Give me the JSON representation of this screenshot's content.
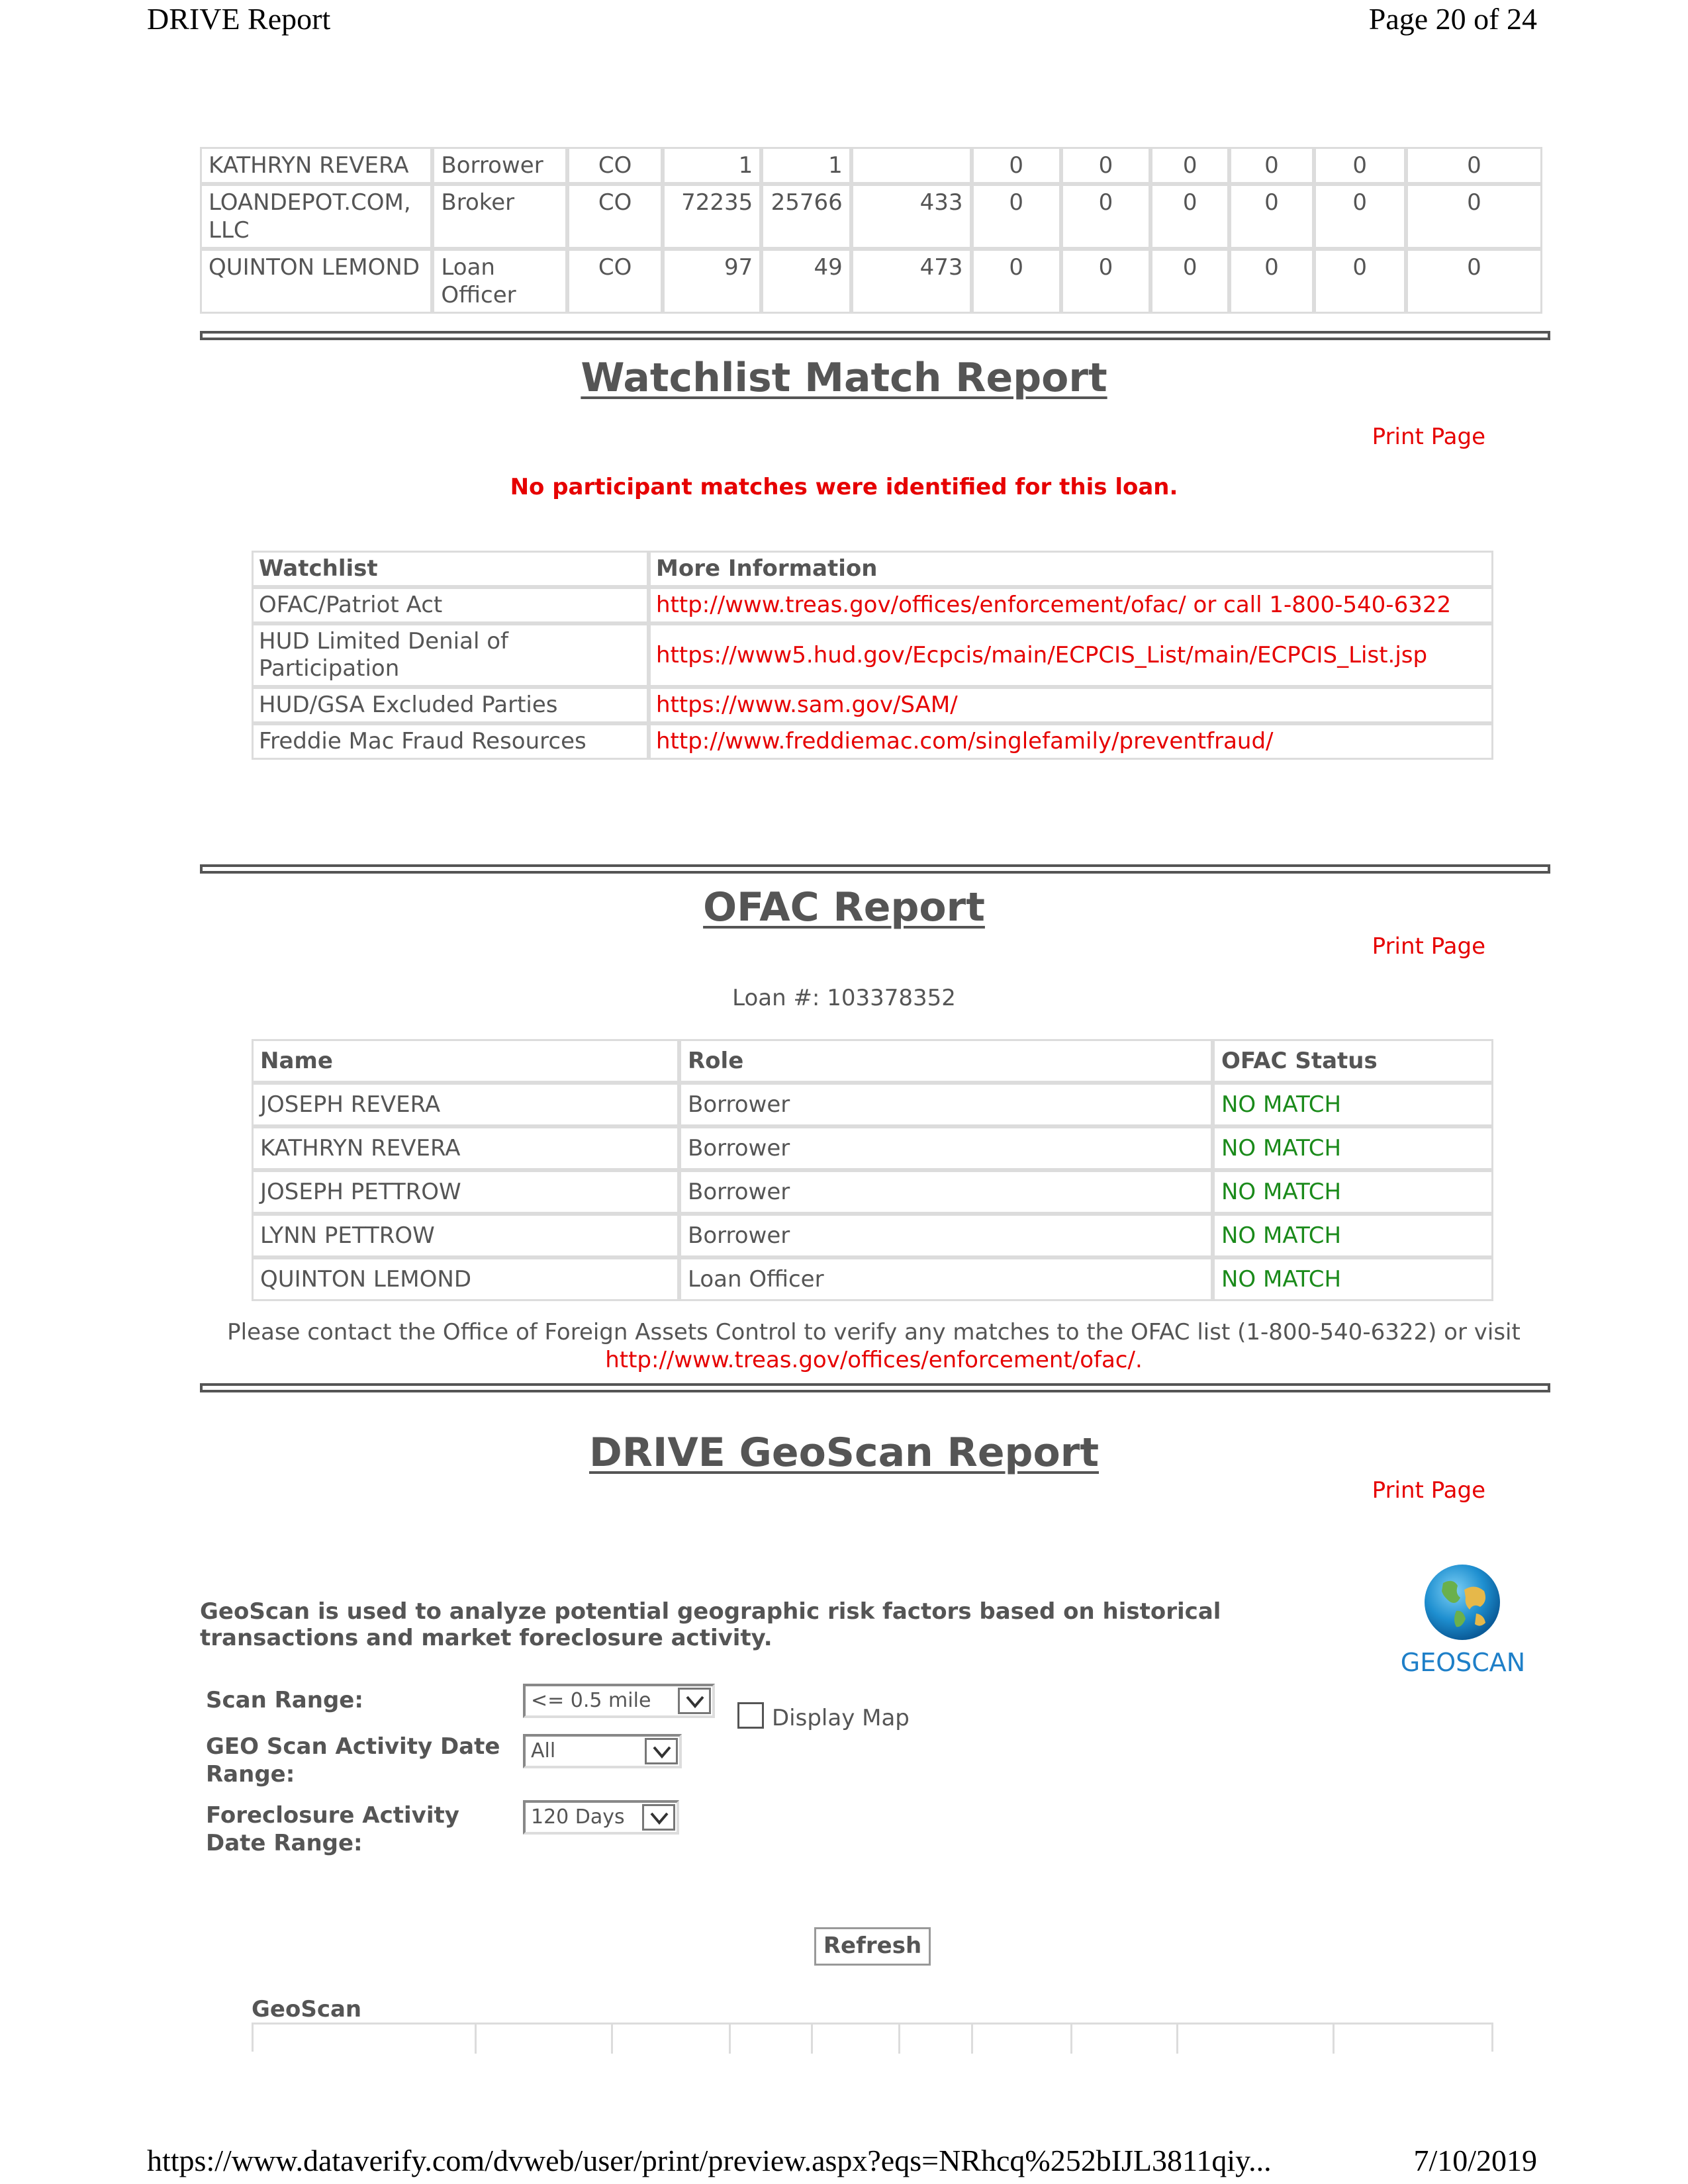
{
  "print_header": {
    "left": "DRIVE Report",
    "right": "Page 20 of 24"
  },
  "print_footer": {
    "left": "https://www.dataverify.com/dvweb/user/print/preview.aspx?eqs=NRhcq%252bIJL3811qiy...",
    "right": "7/10/2019"
  },
  "participants": [
    {
      "name": "KATHRYN REVERA",
      "role": "Borrower",
      "state": "CO",
      "c1": "1",
      "c2": "1",
      "c3": "",
      "c4": "0",
      "c5": "0",
      "c6": "0",
      "c7": "0",
      "c8": "0",
      "c9": "0"
    },
    {
      "name": "LOANDEPOT.COM, LLC",
      "role": "Broker",
      "state": "CO",
      "c1": "72235",
      "c2": "25766",
      "c3": "433",
      "c4": "0",
      "c5": "0",
      "c6": "0",
      "c7": "0",
      "c8": "0",
      "c9": "0"
    },
    {
      "name": "QUINTON LEMOND",
      "role": "Loan Officer",
      "state": "CO",
      "c1": "97",
      "c2": "49",
      "c3": "473",
      "c4": "0",
      "c5": "0",
      "c6": "0",
      "c7": "0",
      "c8": "0",
      "c9": "0"
    }
  ],
  "watchlist": {
    "title": "Watchlist Match Report",
    "print_label": "Print Page",
    "message": "No participant matches were identified for this loan.",
    "headers": [
      "Watchlist",
      "More Information"
    ],
    "rows": [
      {
        "name": "OFAC/Patriot Act",
        "info": "http://www.treas.gov/offices/enforcement/ofac/ or call 1-800-540-6322"
      },
      {
        "name": "HUD Limited Denial of Participation",
        "info": "https://www5.hud.gov/Ecpcis/main/ECPCIS_List/main/ECPCIS_List.jsp"
      },
      {
        "name": "HUD/GSA Excluded Parties",
        "info": "https://www.sam.gov/SAM/"
      },
      {
        "name": "Freddie Mac Fraud Resources",
        "info": "http://www.freddiemac.com/singlefamily/preventfraud/"
      }
    ]
  },
  "ofac": {
    "title": "OFAC Report",
    "print_label": "Print Page",
    "loan_line": "Loan #: 103378352",
    "headers": [
      "Name",
      "Role",
      "OFAC Status"
    ],
    "rows": [
      {
        "name": "JOSEPH REVERA",
        "role": "Borrower",
        "status": "NO MATCH"
      },
      {
        "name": "KATHRYN REVERA",
        "role": "Borrower",
        "status": "NO MATCH"
      },
      {
        "name": "JOSEPH PETTROW",
        "role": "Borrower",
        "status": "NO MATCH"
      },
      {
        "name": "LYNN PETTROW",
        "role": "Borrower",
        "status": "NO MATCH"
      },
      {
        "name": "QUINTON LEMOND",
        "role": "Loan Officer",
        "status": "NO MATCH"
      }
    ],
    "note_text": "Please contact the Office of Foreign Assets Control to verify any matches to the OFAC list (1-800-540-6322) or visit",
    "note_link": "http://www.treas.gov/offices/enforcement/ofac/",
    "note_end": "."
  },
  "geoscan": {
    "title": "DRIVE GeoScan Report",
    "print_label": "Print Page",
    "description": "GeoScan is used to analyze potential geographic risk factors based on historical transactions and market foreclosure activity.",
    "logo_text": "GEOSCAN",
    "scan_range_label": "Scan Range:",
    "scan_range_value": "<= 0.5 mile",
    "display_map_label": "Display Map",
    "activity_date_label": "GEO Scan Activity Date Range:",
    "activity_date_value": "All",
    "foreclosure_label": "Foreclosure Activity Date Range:",
    "foreclosure_value": "120 Days",
    "refresh_label": "Refresh",
    "table_label": "GeoScan"
  }
}
